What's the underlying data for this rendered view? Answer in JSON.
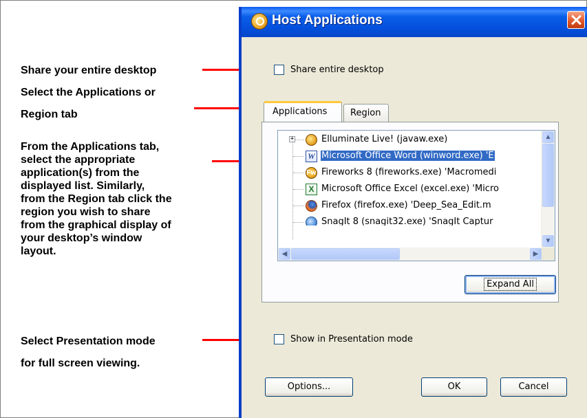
{
  "annotations": {
    "share_desktop": "Share your entire desktop",
    "select_tab_line1": "Select the Applications or",
    "select_tab_line2": "Region tab",
    "from_apps_lines": [
      "From the Applications tab,",
      "select the appropriate",
      "application(s) from the",
      "displayed list.  Similarly,",
      "from the Region tab click the",
      "region you wish to share",
      "from the graphical display of",
      "your desktop’s window",
      "layout."
    ],
    "presentation_line1": "Select Presentation mode",
    "presentation_line2": "for full screen viewing.",
    "line_color": "#ff0000"
  },
  "dialog": {
    "title": "Host Applications",
    "share_desktop_label": "Share entire desktop",
    "share_desktop_checked": false,
    "tabs": [
      {
        "label": "Applications",
        "active": true
      },
      {
        "label": "Region",
        "active": false
      }
    ],
    "tree": {
      "items": [
        {
          "label": "Elluminate Live! (javaw.exe)",
          "icon": "elluminate-icon",
          "selected": false
        },
        {
          "label": "Microsoft Office Word (winword.exe) 'E",
          "icon": "word-icon",
          "selected": true
        },
        {
          "label": "Fireworks 8 (fireworks.exe) 'Macromedi",
          "icon": "fireworks-icon",
          "selected": false
        },
        {
          "label": "Microsoft Office Excel (excel.exe) 'Micro",
          "icon": "excel-icon",
          "selected": false
        },
        {
          "label": "Firefox (firefox.exe) 'Deep_Sea_Edit.m",
          "icon": "firefox-icon",
          "selected": false
        },
        {
          "label": "SnagIt 8 (snagit32.exe) 'SnagIt Captur",
          "icon": "snagit-icon",
          "selected": false
        }
      ],
      "expander_symbol": "+",
      "scroll_up": "▲",
      "scroll_down": "▼",
      "scroll_left": "◀",
      "scroll_right": "▶",
      "selection_color": "#316ac5"
    },
    "expand_all_label": "Expand All",
    "presentation_label": "Show in Presentation mode",
    "presentation_checked": false,
    "options_label": "Options...",
    "ok_label": "OK",
    "cancel_label": "Cancel",
    "title_bar_color": "#0a5ee8",
    "face_color": "#ece9d8"
  }
}
